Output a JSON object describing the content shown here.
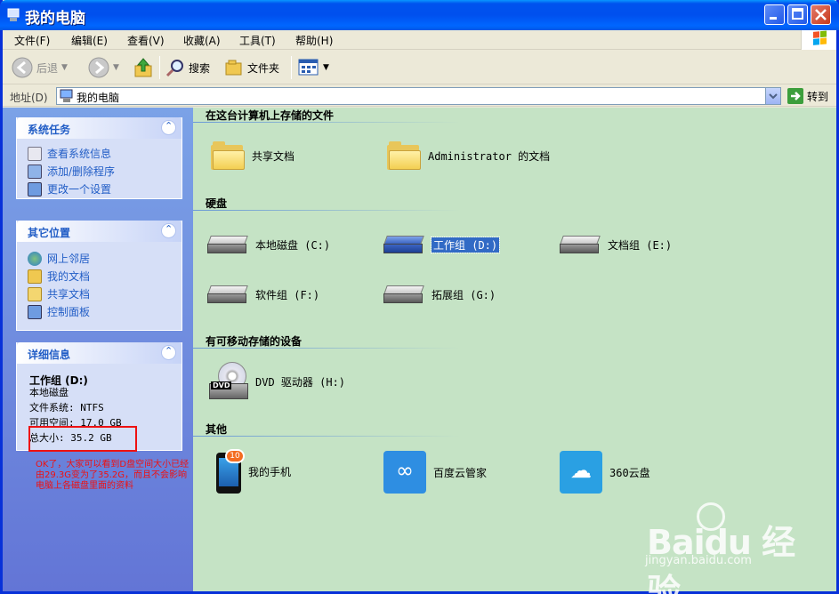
{
  "window": {
    "title": "我的电脑"
  },
  "menu": [
    "文件(F)",
    "编辑(E)",
    "查看(V)",
    "收藏(A)",
    "工具(T)",
    "帮助(H)"
  ],
  "toolbar": {
    "back": "后退",
    "search": "搜索",
    "folders": "文件夹"
  },
  "address": {
    "label": "地址(D)",
    "value": "我的电脑",
    "go": "转到"
  },
  "panels": {
    "system_tasks": {
      "title": "系统任务",
      "items": [
        "查看系统信息",
        "添加/删除程序",
        "更改一个设置"
      ]
    },
    "other_places": {
      "title": "其它位置",
      "items": [
        "网上邻居",
        "我的文档",
        "共享文档",
        "控制面板"
      ]
    },
    "details": {
      "title": "详细信息",
      "name": "工作组 (D:)",
      "type": "本地磁盘",
      "fs": "文件系统: NTFS",
      "free": "可用空间: 17.0 GB",
      "total": "总大小: 35.2 GB"
    }
  },
  "annotation": "OK了，大家可以看到D盘空间大小已经由29.3G变为了35.2G，而且不会影响电脑上各磁盘里面的资料",
  "groups": {
    "files": {
      "title": "在这台计算机上存储的文件",
      "items": [
        "共享文档",
        "Administrator 的文档"
      ]
    },
    "drives": {
      "title": "硬盘",
      "items": [
        "本地磁盘 (C:)",
        "工作组 (D:)",
        "文档组 (E:)",
        "软件组 (F:)",
        "拓展组 (G:)"
      ]
    },
    "removable": {
      "title": "有可移动存储的设备",
      "items": [
        "DVD 驱动器 (H:)"
      ]
    },
    "other": {
      "title": "其他",
      "items": [
        "我的手机",
        "百度云管家",
        "360云盘"
      ],
      "phone_badge": "10"
    }
  },
  "watermark": {
    "logo": "Baidu 经验",
    "url": "jingyan.baidu.com"
  },
  "colors": {
    "titlebar": "#0053ee",
    "main_bg": "#c5e3c5",
    "left_panel": "#7ba2e7",
    "highlight": "#316ac5",
    "annotation": "#ee1111"
  }
}
